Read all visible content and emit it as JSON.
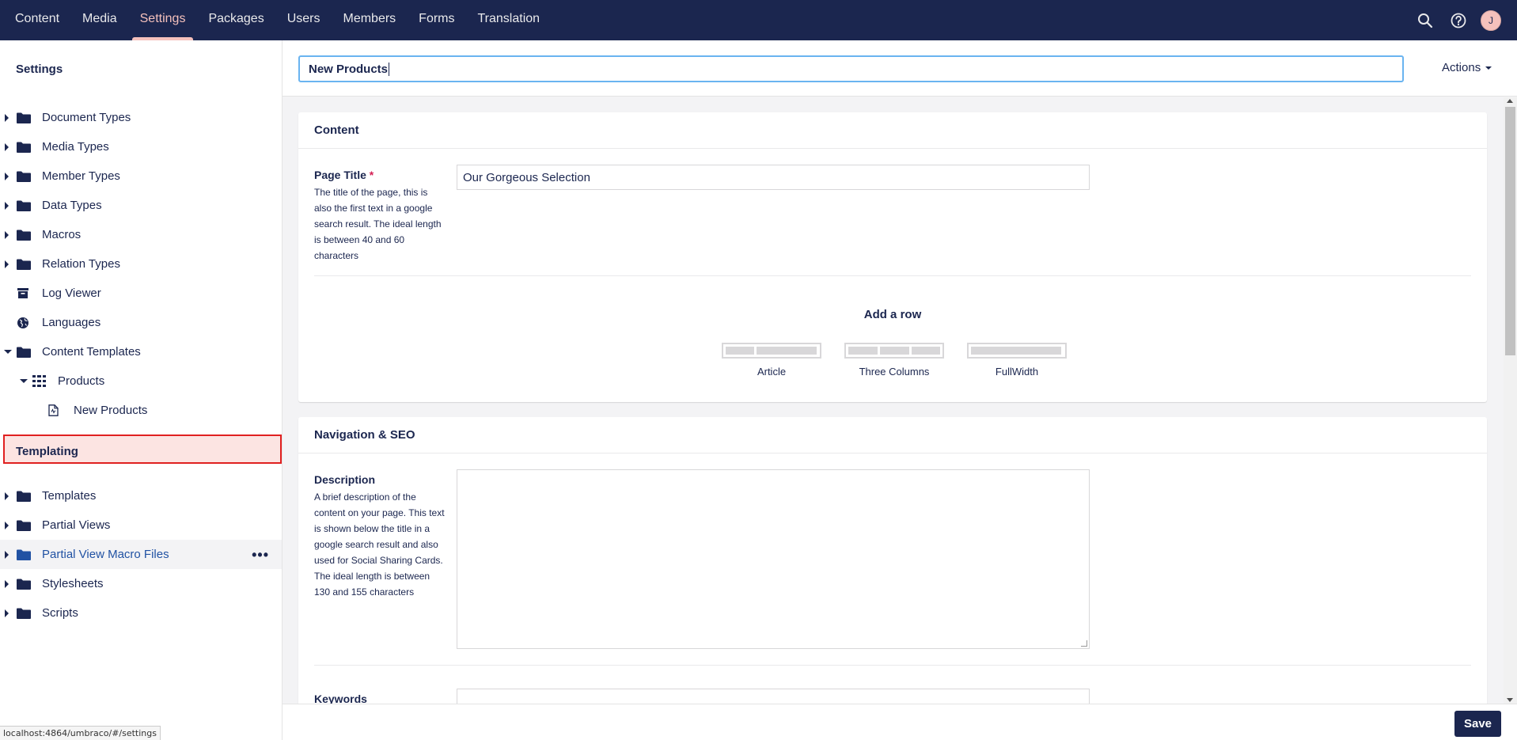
{
  "topbar": {
    "nav": [
      "Content",
      "Media",
      "Settings",
      "Packages",
      "Users",
      "Members",
      "Forms",
      "Translation"
    ],
    "active": "Settings",
    "avatar_initial": "J",
    "icons": [
      "search-icon",
      "help-icon",
      "avatar"
    ]
  },
  "sidebar": {
    "settings_title": "Settings",
    "settings_items": [
      {
        "label": "Document Types",
        "icon": "folder-icon",
        "expand": "collapsed"
      },
      {
        "label": "Media Types",
        "icon": "folder-icon",
        "expand": "collapsed"
      },
      {
        "label": "Member Types",
        "icon": "folder-icon",
        "expand": "collapsed"
      },
      {
        "label": "Data Types",
        "icon": "folder-icon",
        "expand": "collapsed"
      },
      {
        "label": "Macros",
        "icon": "folder-icon",
        "expand": "collapsed"
      },
      {
        "label": "Relation Types",
        "icon": "folder-icon",
        "expand": "collapsed"
      },
      {
        "label": "Log Viewer",
        "icon": "archive-icon",
        "expand": "none"
      },
      {
        "label": "Languages",
        "icon": "globe-icon",
        "expand": "none"
      },
      {
        "label": "Content Templates",
        "icon": "folder-icon",
        "expand": "expanded"
      },
      {
        "label": "Products",
        "icon": "grid-icon",
        "expand": "expanded"
      },
      {
        "label": "New Products",
        "icon": "document-icon",
        "expand": "none",
        "selected": true
      }
    ],
    "templating_title": "Templating",
    "templating_items": [
      {
        "label": "Templates",
        "icon": "folder-icon"
      },
      {
        "label": "Partial Views",
        "icon": "folder-icon"
      },
      {
        "label": "Partial View Macro Files",
        "icon": "folder-icon",
        "hover": true
      },
      {
        "label": "Stylesheets",
        "icon": "folder-icon"
      },
      {
        "label": "Scripts",
        "icon": "folder-icon"
      }
    ],
    "status_url": "localhost:4864/umbraco/#/settings"
  },
  "header": {
    "name_value": "New Products",
    "actions_label": "Actions"
  },
  "content_panel": {
    "title": "Content",
    "page_title_label": "Page Title",
    "required_mark": "*",
    "page_title_desc": "The title of the page, this is also the first text in a google search result. The ideal length is between 40 and 60 characters",
    "page_title_value": "Our Gorgeous Selection",
    "add_row_title": "Add a row",
    "layouts": [
      "Article",
      "Three Columns",
      "FullWidth"
    ]
  },
  "seo_panel": {
    "title": "Navigation & SEO",
    "description_label": "Description",
    "description_desc": "A brief description of the content on your page. This text is shown below the title in a google search result and also used for Social Sharing Cards. The ideal length is between 130 and 155 characters",
    "description_value": "",
    "keywords_label": "Keywords"
  },
  "footer": {
    "save_label": "Save"
  },
  "colors": {
    "topbar": "#1b264f",
    "active_nav": "#f5c1bc",
    "selection_border": "#e02020",
    "input_focus": "#6ab4f0"
  }
}
